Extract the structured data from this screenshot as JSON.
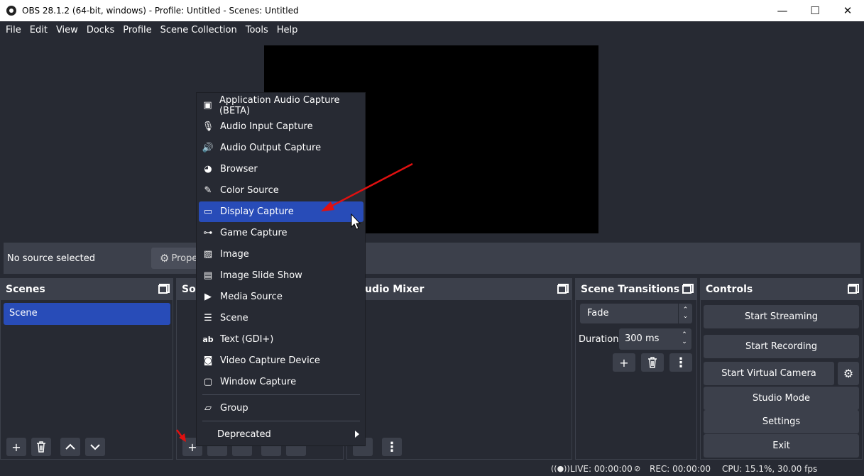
{
  "window": {
    "title": "OBS 28.1.2 (64-bit, windows) - Profile: Untitled - Scenes: Untitled",
    "minimize": "—",
    "maximize": "☐",
    "close": "✕"
  },
  "menu": [
    "File",
    "Edit",
    "View",
    "Docks",
    "Profile",
    "Scene Collection",
    "Tools",
    "Help"
  ],
  "source_bar": {
    "no_source": "No source selected",
    "properties_label": "Prope"
  },
  "docks": {
    "scenes": {
      "title": "Scenes",
      "items": [
        "Scene"
      ]
    },
    "sources": {
      "title": "So"
    },
    "audio_mixer": {
      "title": "udio Mixer"
    },
    "scene_transitions": {
      "title": "Scene Transitions",
      "transition": "Fade",
      "duration_label": "Duration",
      "duration_value": "300 ms"
    },
    "controls": {
      "title": "Controls",
      "start_streaming": "Start Streaming",
      "start_recording": "Start Recording",
      "start_virtual_camera": "Start Virtual Camera",
      "studio_mode": "Studio Mode",
      "settings": "Settings",
      "exit": "Exit"
    }
  },
  "context_menu": {
    "items": [
      {
        "label": "Application Audio Capture (BETA)",
        "icon": "app-audio-icon"
      },
      {
        "label": "Audio Input Capture",
        "icon": "microphone-icon"
      },
      {
        "label": "Audio Output Capture",
        "icon": "speaker-icon"
      },
      {
        "label": "Browser",
        "icon": "globe-icon"
      },
      {
        "label": "Color Source",
        "icon": "brush-icon"
      },
      {
        "label": "Display Capture",
        "icon": "monitor-icon",
        "selected": true
      },
      {
        "label": "Game Capture",
        "icon": "gamepad-icon"
      },
      {
        "label": "Image",
        "icon": "image-icon"
      },
      {
        "label": "Image Slide Show",
        "icon": "slideshow-icon"
      },
      {
        "label": "Media Source",
        "icon": "play-icon"
      },
      {
        "label": "Scene",
        "icon": "list-icon"
      },
      {
        "label": "Text (GDI+)",
        "icon": "text-icon"
      },
      {
        "label": "Video Capture Device",
        "icon": "camera-icon"
      },
      {
        "label": "Window Capture",
        "icon": "window-icon"
      }
    ],
    "group": "Group",
    "deprecated": "Deprecated"
  },
  "status": {
    "live": "LIVE: 00:00:00",
    "rec": "REC: 00:00:00",
    "cpu": "CPU: 15.1%, 30.00 fps"
  },
  "colors": {
    "accent": "#284cb8",
    "annotation_arrow": "#e01010"
  }
}
